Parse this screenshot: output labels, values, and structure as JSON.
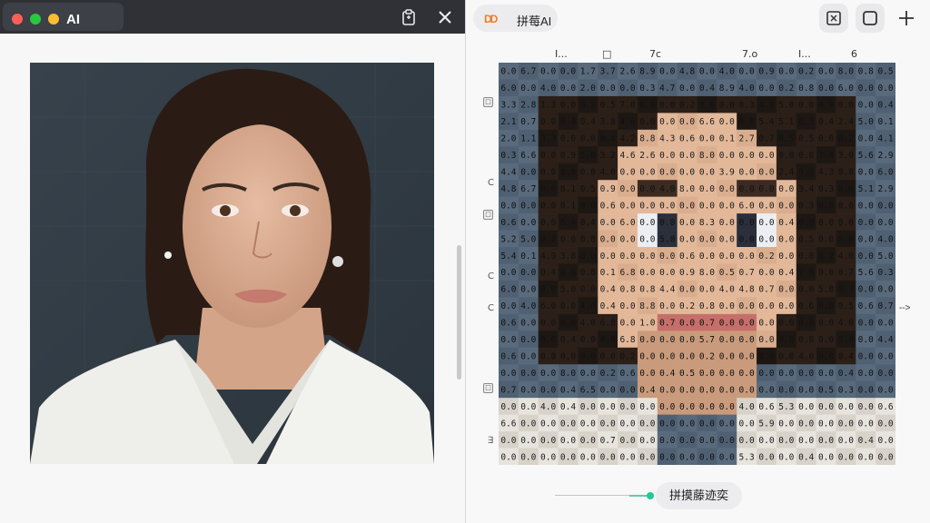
{
  "left_window": {
    "tab_title": "AI",
    "icons": [
      "clipboard-icon",
      "close-icon"
    ]
  },
  "right_window": {
    "brand_logo": "DD",
    "brand_title": "拼莓AI",
    "toolbar_icons": [
      "puzzle-icon",
      "square-icon",
      "plus-icon"
    ],
    "column_labels": [
      "I...",
      "□",
      "7c",
      "7.o",
      "I...",
      "6"
    ],
    "row_labels": [
      "□",
      "C",
      "□",
      "C",
      "C",
      "□",
      "∃"
    ],
    "arrow_mark": "-->",
    "style_button": "拼摸藤迹奕"
  },
  "mosaic_values": [
    "0.0",
    "6.7",
    "0.0",
    "0.0",
    "1.7",
    "3.7",
    "2.6",
    "8.9",
    "0.0",
    "4.8",
    "0.0",
    "4.0",
    "0.0",
    "0.9",
    "0.0",
    "0.2",
    "0.0",
    "8.0",
    "0.8",
    "0.5",
    "6.0",
    "0.0",
    "4.0",
    "0.0",
    "2.0",
    "0.0",
    "0.0",
    "0.3",
    "4.7",
    "0.0",
    "0.4",
    "8.9",
    "4.0",
    "0.0",
    "0.2",
    "0.8",
    "0.0",
    "6.0",
    "0.0",
    "0.0",
    "3.3",
    "2.8",
    "1.3",
    "0.0",
    "0.2",
    "0.5",
    "7.0",
    "0.0",
    "0.0",
    "0.2",
    "0.6",
    "0.0",
    "0.3",
    "4.8",
    "5.0",
    "0.0",
    "4.9",
    "0.0",
    "0.0",
    "0.4",
    "2.1",
    "0.7",
    "0.0",
    "0.4",
    "0.4",
    "3.8",
    "4.6",
    "0.0",
    "0.0",
    "0.0",
    "6.6",
    "0.0",
    "0.0",
    "5.4",
    "5.1",
    "6.3",
    "0.4",
    "2.4",
    "5.0",
    "0.1",
    "2.0",
    "1.1",
    "3.3",
    "0.0",
    "0.0",
    "0.4",
    "4.2",
    "8.8",
    "4.3",
    "0.6",
    "0.0",
    "0.1",
    "2.7",
    "0.7",
    "0.5",
    "0.5",
    "0.0",
    "0.2",
    "0.0",
    "4.1",
    "0.3",
    "6.6",
    "0.0",
    "0.9",
    "5.0",
    "3.2",
    "4.6",
    "2.6",
    "0.0",
    "0.0",
    "8.0",
    "0.0",
    "0.0",
    "0.0",
    "0.0",
    "0.0",
    "7.4",
    "3.0",
    "5.6",
    "2.9",
    "4.4",
    "0.0",
    "0.0",
    "0.0",
    "0.0",
    "4.0",
    "0.0",
    "0.0",
    "0.0",
    "0.0",
    "0.0",
    "3.9",
    "0.0",
    "0.0",
    "2.4",
    "0.3",
    "4.3",
    "0.8",
    "0.0",
    "6.0",
    "4.8",
    "6.7",
    "0.0",
    "8.1",
    "0.5",
    "0.9",
    "0.0",
    "0.0",
    "4.0",
    "8.0",
    "0.0",
    "0.0",
    "0.0",
    "0.0",
    "0.0",
    "3.4",
    "0.3",
    "0.6",
    "5.1",
    "2.9",
    "0.0",
    "0.0",
    "0.0",
    "0.1",
    "0.0",
    "0.6",
    "0.0",
    "0.0",
    "0.0",
    "0.0",
    "0.0",
    "0.0",
    "6.0",
    "0.0",
    "0.0",
    "0.3",
    "0.0",
    "0.0",
    "0.0",
    "0.0",
    "0.6",
    "0.0",
    "0.0",
    "6.4",
    "0.4",
    "0.0",
    "6.0",
    "0.0",
    "0.0",
    "0.0",
    "8.3",
    "0.0",
    "0.0",
    "0.0",
    "0.4",
    "0.0",
    "0.0",
    "0.0",
    "0.0",
    "0.0",
    "5.2",
    "5.0",
    "0.2",
    "0.0",
    "0.8",
    "0.0",
    "0.0",
    "0.0",
    "5.0",
    "0.0",
    "0.0",
    "0.0",
    "0.0",
    "0.0",
    "0.0",
    "0.5",
    "0.0",
    "0.6",
    "0.0",
    "4.0",
    "5.4",
    "0.1",
    "4.9",
    "3.8",
    "0.0",
    "0.0",
    "0.0",
    "0.0",
    "0.0",
    "0.6",
    "0.0",
    "0.0",
    "0.0",
    "0.2",
    "0.0",
    "0.0",
    "0.2",
    "4.0",
    "0.0",
    "5.0",
    "0.0",
    "0.0",
    "0.4",
    "0.0",
    "0.8",
    "0.1",
    "6.8",
    "0.0",
    "0.0",
    "0.9",
    "8.0",
    "0.5",
    "0.7",
    "0.0",
    "0.4",
    "7.8",
    "0.0",
    "0.7",
    "5.6",
    "0.3",
    "6.0",
    "0.0",
    "0.0",
    "5.0",
    "0.0",
    "0.4",
    "0.8",
    "0.8",
    "4.4",
    "0.0",
    "0.0",
    "4.0",
    "4.8",
    "0.7",
    "0.0",
    "0.0",
    "5.0",
    "0.7",
    "0.0",
    "0.0",
    "0.0",
    "4.0",
    "6.0",
    "0.0",
    "4.0",
    "0.4",
    "0.0",
    "8.8",
    "0.0",
    "0.2",
    "0.8",
    "0.0",
    "0.0",
    "0.0",
    "0.0",
    "0.6",
    "0.0",
    "0.5",
    "0.6",
    "0.7",
    "0.6",
    "0.0",
    "0.0",
    "0.0",
    "4.0",
    "6.8",
    "0.0",
    "1.0",
    "0.7",
    "0.0",
    "0.7",
    "0.0",
    "0.0",
    "0.0",
    "0.0",
    "0.0",
    "0.0",
    "4.0",
    "0.0",
    "0.0",
    "0.0",
    "0.0",
    "0.0",
    "0.4",
    "0.0",
    "0.0",
    "6.8",
    "0.0",
    "0.0",
    "0.0",
    "5.7",
    "0.0",
    "0.0",
    "0.0",
    "0.0",
    "0.0",
    "0.0",
    "5.0",
    "0.0",
    "4.4",
    "0.6",
    "0.0",
    "0.0",
    "0.0",
    "0.0",
    "0.0",
    "0.2",
    "0.0",
    "0.0",
    "0.0",
    "0.2",
    "0.0",
    "0.0",
    "0.0",
    "0.0",
    "4.0",
    "0.0",
    "0.4",
    "0.0",
    "0.0",
    "0.0",
    "0.0",
    "0.0",
    "8.0",
    "0.0",
    "0.2",
    "0.6",
    "0.0",
    "0.4",
    "0.5",
    "0.0",
    "0.0",
    "0.0",
    "0.0",
    "0.0",
    "0.0",
    "0.0",
    "0.4",
    "0.0",
    "0.0",
    "0.7",
    "0.0",
    "0.0",
    "0.4",
    "6.5",
    "0.0",
    "0.0",
    "0.4",
    "0.0",
    "0.0",
    "0.0",
    "0.0",
    "0.0",
    "0.0",
    "0.0",
    "0.0",
    "0.5",
    "0.3",
    "0.0",
    "0.0",
    "0.0",
    "0.0",
    "4.0",
    "0.4",
    "0.0",
    "0.0",
    "0.0",
    "0.0",
    "0.0",
    "0.0",
    "0.0",
    "0.0",
    "4.0",
    "0.6",
    "5.3",
    "0.0",
    "0.0",
    "0.0",
    "0.0",
    "0.6",
    "6.6",
    "0.0",
    "0.0",
    "0.0",
    "0.0",
    "0.0",
    "0.0",
    "0.0",
    "0.0",
    "0.0",
    "0.0",
    "0.0",
    "0.0",
    "5.9",
    "0.0",
    "0.0",
    "0.0",
    "0.0",
    "0.0",
    "0.0",
    "0.0",
    "0.0",
    "0.0",
    "0.0",
    "0.0",
    "0.7",
    "0.0",
    "0.0",
    "0.0",
    "0.0",
    "0.0",
    "0.0",
    "0.0",
    "0.0",
    "0.0",
    "0.0",
    "0.0",
    "0.0",
    "0.4",
    "0.0",
    "0.0",
    "0.0",
    "0.0",
    "0.0",
    "0.0",
    "0.0",
    "0.0",
    "0.0",
    "0.0",
    "0.0",
    "0.0",
    "0.0",
    "5.3",
    "0.0",
    "0.0",
    "0.4",
    "0.0",
    "0.0",
    "0.0",
    "0.0",
    "0.0",
    "0.0",
    "0.0",
    "0.0",
    "0.0",
    "0.0",
    "0.0",
    "0.0",
    "0.0",
    "0.0",
    "0.0",
    "0.0",
    "0.0",
    "0.0",
    "0.0",
    "0.0",
    "0.0",
    "0.0",
    "0.0",
    "0.0",
    "0.0",
    "0.0",
    "0.0",
    "0.0",
    "0.0",
    "0.0",
    "0.0",
    "0.0",
    "0.0",
    "0.0",
    "0.0",
    "0.0",
    "0.0",
    "0.0",
    "0.0",
    "0.0",
    "0.0",
    "0.0",
    "0.0",
    "0.0",
    "0.0",
    "0.0",
    "2.0",
    "0.0",
    "0.0"
  ]
}
